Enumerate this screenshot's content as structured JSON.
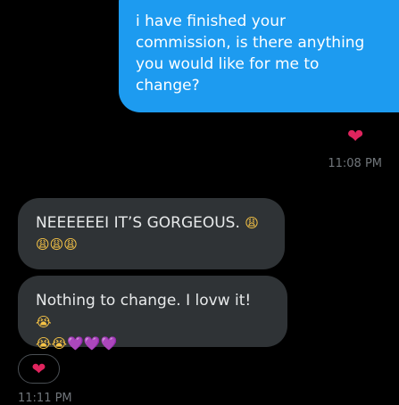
{
  "messages": {
    "sent": {
      "text": "i have finished your\ncommission, is there anything\nyou would like for me to\nchange?",
      "reaction": "❤",
      "timestamp": "11:08 PM"
    },
    "received": [
      {
        "text": "NEEEEEEI IT’S GORGEOUS.",
        "emojis": [
          "😩",
          "😩",
          "😩",
          "😩"
        ]
      },
      {
        "text": "Nothing to change. I lovw it!",
        "emojis": [
          "😭",
          "😭",
          "😭",
          "💜",
          "💜",
          "💜"
        ]
      }
    ],
    "received_reaction": "❤",
    "received_timestamp": "11:11 PM"
  },
  "colors": {
    "sent_bubble": "#1d9bf0",
    "received_bubble": "#2f3336",
    "heart": "#e0245e",
    "timestamp": "#71767b",
    "background": "#000000"
  },
  "icons": {
    "reaction": "heart-icon"
  }
}
